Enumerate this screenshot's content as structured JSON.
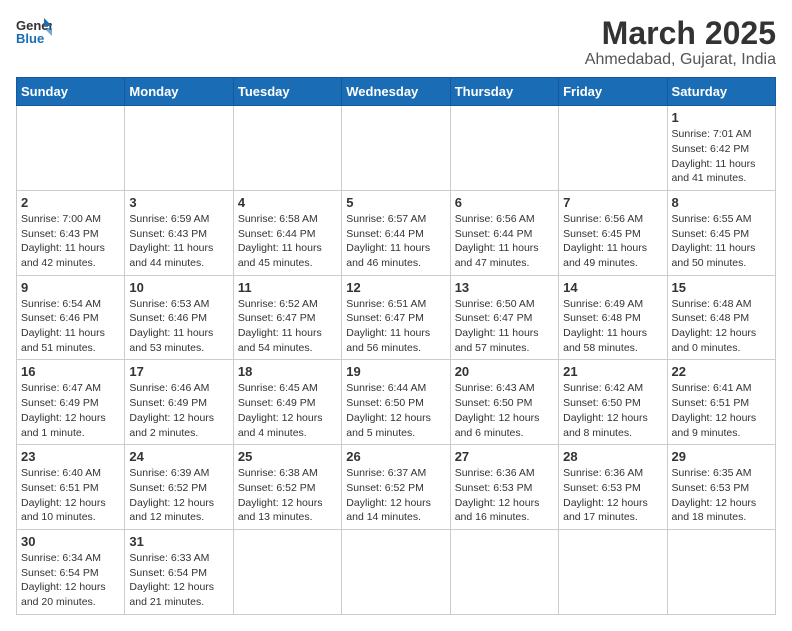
{
  "header": {
    "logo_line1": "General",
    "logo_line2": "Blue",
    "month_title": "March 2025",
    "location": "Ahmedabad, Gujarat, India"
  },
  "weekdays": [
    "Sunday",
    "Monday",
    "Tuesday",
    "Wednesday",
    "Thursday",
    "Friday",
    "Saturday"
  ],
  "weeks": [
    [
      {
        "day": "",
        "info": ""
      },
      {
        "day": "",
        "info": ""
      },
      {
        "day": "",
        "info": ""
      },
      {
        "day": "",
        "info": ""
      },
      {
        "day": "",
        "info": ""
      },
      {
        "day": "",
        "info": ""
      },
      {
        "day": "1",
        "info": "Sunrise: 7:01 AM\nSunset: 6:42 PM\nDaylight: 11 hours and 41 minutes."
      }
    ],
    [
      {
        "day": "2",
        "info": "Sunrise: 7:00 AM\nSunset: 6:43 PM\nDaylight: 11 hours and 42 minutes."
      },
      {
        "day": "3",
        "info": "Sunrise: 6:59 AM\nSunset: 6:43 PM\nDaylight: 11 hours and 44 minutes."
      },
      {
        "day": "4",
        "info": "Sunrise: 6:58 AM\nSunset: 6:44 PM\nDaylight: 11 hours and 45 minutes."
      },
      {
        "day": "5",
        "info": "Sunrise: 6:57 AM\nSunset: 6:44 PM\nDaylight: 11 hours and 46 minutes."
      },
      {
        "day": "6",
        "info": "Sunrise: 6:56 AM\nSunset: 6:44 PM\nDaylight: 11 hours and 47 minutes."
      },
      {
        "day": "7",
        "info": "Sunrise: 6:56 AM\nSunset: 6:45 PM\nDaylight: 11 hours and 49 minutes."
      },
      {
        "day": "8",
        "info": "Sunrise: 6:55 AM\nSunset: 6:45 PM\nDaylight: 11 hours and 50 minutes."
      }
    ],
    [
      {
        "day": "9",
        "info": "Sunrise: 6:54 AM\nSunset: 6:46 PM\nDaylight: 11 hours and 51 minutes."
      },
      {
        "day": "10",
        "info": "Sunrise: 6:53 AM\nSunset: 6:46 PM\nDaylight: 11 hours and 53 minutes."
      },
      {
        "day": "11",
        "info": "Sunrise: 6:52 AM\nSunset: 6:47 PM\nDaylight: 11 hours and 54 minutes."
      },
      {
        "day": "12",
        "info": "Sunrise: 6:51 AM\nSunset: 6:47 PM\nDaylight: 11 hours and 56 minutes."
      },
      {
        "day": "13",
        "info": "Sunrise: 6:50 AM\nSunset: 6:47 PM\nDaylight: 11 hours and 57 minutes."
      },
      {
        "day": "14",
        "info": "Sunrise: 6:49 AM\nSunset: 6:48 PM\nDaylight: 11 hours and 58 minutes."
      },
      {
        "day": "15",
        "info": "Sunrise: 6:48 AM\nSunset: 6:48 PM\nDaylight: 12 hours and 0 minutes."
      }
    ],
    [
      {
        "day": "16",
        "info": "Sunrise: 6:47 AM\nSunset: 6:49 PM\nDaylight: 12 hours and 1 minute."
      },
      {
        "day": "17",
        "info": "Sunrise: 6:46 AM\nSunset: 6:49 PM\nDaylight: 12 hours and 2 minutes."
      },
      {
        "day": "18",
        "info": "Sunrise: 6:45 AM\nSunset: 6:49 PM\nDaylight: 12 hours and 4 minutes."
      },
      {
        "day": "19",
        "info": "Sunrise: 6:44 AM\nSunset: 6:50 PM\nDaylight: 12 hours and 5 minutes."
      },
      {
        "day": "20",
        "info": "Sunrise: 6:43 AM\nSunset: 6:50 PM\nDaylight: 12 hours and 6 minutes."
      },
      {
        "day": "21",
        "info": "Sunrise: 6:42 AM\nSunset: 6:50 PM\nDaylight: 12 hours and 8 minutes."
      },
      {
        "day": "22",
        "info": "Sunrise: 6:41 AM\nSunset: 6:51 PM\nDaylight: 12 hours and 9 minutes."
      }
    ],
    [
      {
        "day": "23",
        "info": "Sunrise: 6:40 AM\nSunset: 6:51 PM\nDaylight: 12 hours and 10 minutes."
      },
      {
        "day": "24",
        "info": "Sunrise: 6:39 AM\nSunset: 6:52 PM\nDaylight: 12 hours and 12 minutes."
      },
      {
        "day": "25",
        "info": "Sunrise: 6:38 AM\nSunset: 6:52 PM\nDaylight: 12 hours and 13 minutes."
      },
      {
        "day": "26",
        "info": "Sunrise: 6:37 AM\nSunset: 6:52 PM\nDaylight: 12 hours and 14 minutes."
      },
      {
        "day": "27",
        "info": "Sunrise: 6:36 AM\nSunset: 6:53 PM\nDaylight: 12 hours and 16 minutes."
      },
      {
        "day": "28",
        "info": "Sunrise: 6:36 AM\nSunset: 6:53 PM\nDaylight: 12 hours and 17 minutes."
      },
      {
        "day": "29",
        "info": "Sunrise: 6:35 AM\nSunset: 6:53 PM\nDaylight: 12 hours and 18 minutes."
      }
    ],
    [
      {
        "day": "30",
        "info": "Sunrise: 6:34 AM\nSunset: 6:54 PM\nDaylight: 12 hours and 20 minutes."
      },
      {
        "day": "31",
        "info": "Sunrise: 6:33 AM\nSunset: 6:54 PM\nDaylight: 12 hours and 21 minutes."
      },
      {
        "day": "",
        "info": ""
      },
      {
        "day": "",
        "info": ""
      },
      {
        "day": "",
        "info": ""
      },
      {
        "day": "",
        "info": ""
      },
      {
        "day": "",
        "info": ""
      }
    ]
  ]
}
